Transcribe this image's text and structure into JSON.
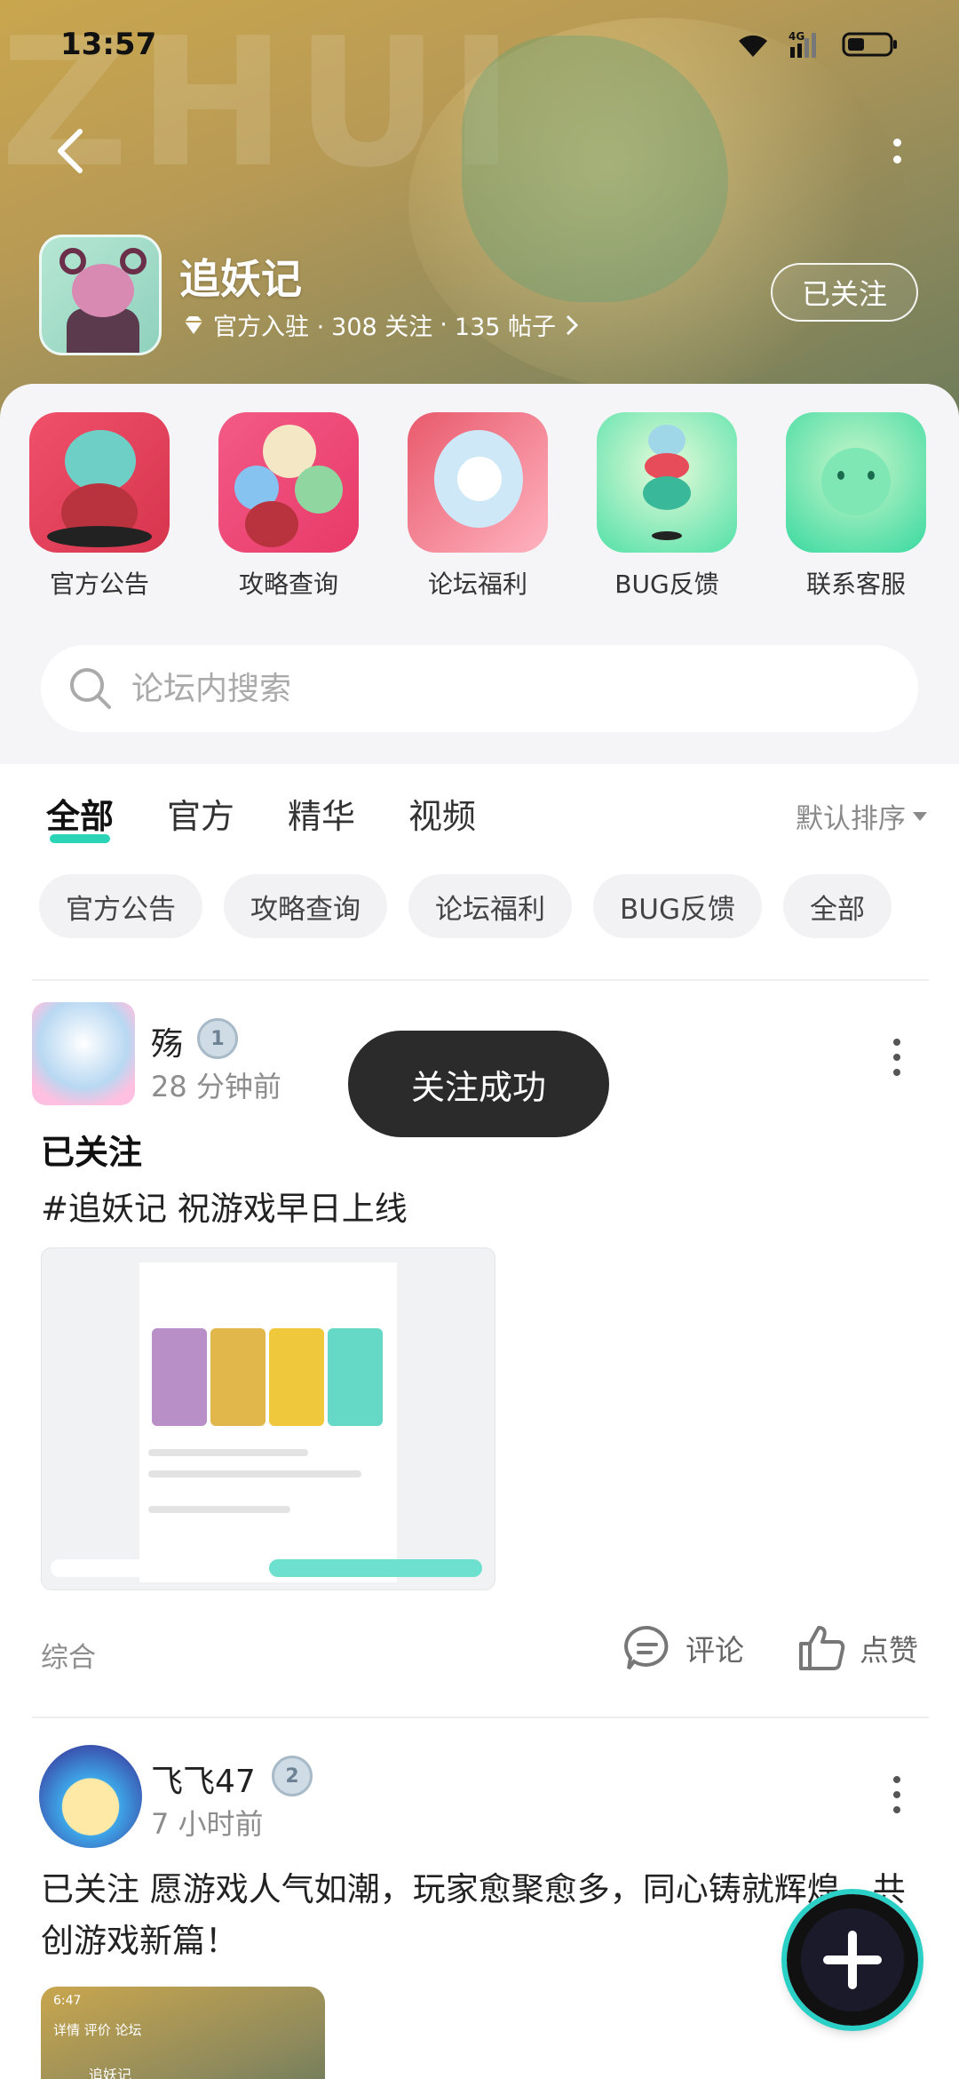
{
  "status": {
    "time": "13:57",
    "network": "4G"
  },
  "header": {
    "game_name": "追妖记",
    "meta_prefix": "官方入驻 · ",
    "followers": "308 关注",
    "separator": " · ",
    "posts": "135 帖子",
    "follow_label": "已关注"
  },
  "quick_links": [
    {
      "label": "官方公告"
    },
    {
      "label": "攻略查询"
    },
    {
      "label": "论坛福利"
    },
    {
      "label": "BUG反馈"
    },
    {
      "label": "联系客服"
    }
  ],
  "search": {
    "placeholder": "论坛内搜索"
  },
  "tabs": [
    {
      "label": "全部",
      "active": true
    },
    {
      "label": "官方"
    },
    {
      "label": "精华"
    },
    {
      "label": "视频"
    }
  ],
  "sort": {
    "label": "默认排序"
  },
  "chips": [
    "官方公告",
    "攻略查询",
    "论坛福利",
    "BUG反馈",
    "全部"
  ],
  "toast": "关注成功",
  "posts": [
    {
      "author": "殇",
      "level": "1",
      "time": "28 分钟前",
      "title": "已关注",
      "text": "#追妖记 祝游戏早日上线",
      "category": "综合",
      "comment_label": "评论",
      "like_label": "点赞"
    },
    {
      "author": "飞飞47",
      "level": "2",
      "time": "7 小时前",
      "text": "已关注 愿游戏人气如潮，玩家愈聚愈多，同心铸就辉煌，共创游戏新篇！",
      "thumb_time": "6:47",
      "thumb_tabs": "详情   评价   论坛",
      "thumb_name": "追妖记"
    }
  ],
  "colors": {
    "accent": "#2bd3b7",
    "toast_bg": "#2b2b2b"
  }
}
